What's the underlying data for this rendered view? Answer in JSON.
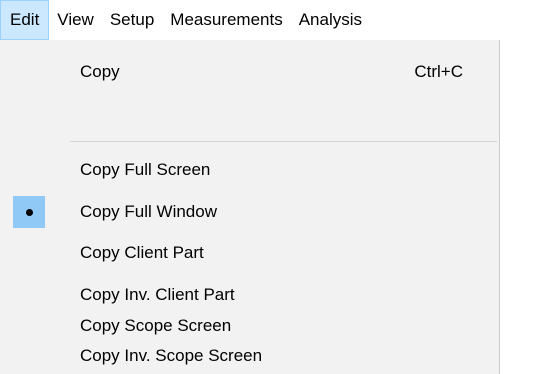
{
  "menubar": {
    "items": [
      {
        "label": "Edit"
      },
      {
        "label": "View"
      },
      {
        "label": "Setup"
      },
      {
        "label": "Measurements"
      },
      {
        "label": "Analysis"
      }
    ]
  },
  "edit_menu": {
    "copy": {
      "label": "Copy",
      "shortcut": "Ctrl+C"
    },
    "items": [
      {
        "label": "Copy Full Screen",
        "checked": false
      },
      {
        "label": "Copy Full Window",
        "checked": true
      },
      {
        "label": "Copy Client Part",
        "checked": false
      },
      {
        "label": "Copy Inv. Client Part",
        "checked": false
      },
      {
        "label": "Copy Scope Screen",
        "checked": false
      },
      {
        "label": "Copy Inv. Scope Screen",
        "checked": false
      }
    ]
  },
  "colors": {
    "active_menu_bg": "#cce8ff",
    "checked_bg": "#90c8f6",
    "menu_bg": "#f2f2f2"
  }
}
